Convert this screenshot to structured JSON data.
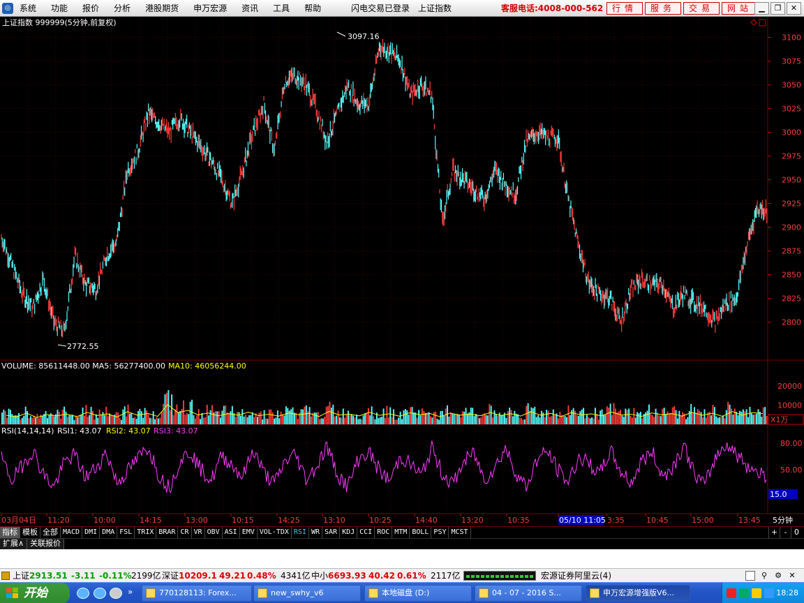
{
  "menubar": {
    "items": [
      "系统",
      "功能",
      "报价",
      "分析",
      "港股期货",
      "申万宏源",
      "资讯",
      "工具",
      "帮助"
    ],
    "login_status": "闪电交易已登录",
    "current_index": "上证指数",
    "hotline": "客服电话:4008-000-562",
    "quick_buttons": [
      "行情",
      "服务",
      "交易",
      "网站"
    ],
    "window_controls": [
      "minimize-icon",
      "restore-icon",
      "close-icon"
    ]
  },
  "chart": {
    "title": "上证指数 999999(5分钟,前复权)",
    "high_label": "3097.16",
    "low_label": "2772.55",
    "price_ticks": [
      3100,
      3075,
      3050,
      3025,
      3000,
      2975,
      2950,
      2925,
      2900,
      2875,
      2850,
      2825,
      2800
    ],
    "price_range": [
      2760,
      3110
    ],
    "close_line": [
      2890,
      2860,
      2830,
      2815,
      2845,
      2800,
      2790,
      2870,
      2840,
      2835,
      2870,
      2885,
      2960,
      2980,
      3020,
      3010,
      3000,
      3015,
      3000,
      2985,
      2970,
      2950,
      2925,
      2960,
      3000,
      3030,
      2980,
      3055,
      3060,
      3050,
      3025,
      2990,
      3020,
      3050,
      3030,
      3030,
      3090,
      3085,
      3075,
      3040,
      3050,
      3040,
      2905,
      2960,
      2950,
      2940,
      2930,
      2960,
      2945,
      2935,
      2990,
      3000,
      2995,
      2995,
      2930,
      2880,
      2840,
      2830,
      2825,
      2800,
      2835,
      2845,
      2840,
      2840,
      2815,
      2830,
      2820,
      2815,
      2800,
      2820,
      2825,
      2880,
      2920,
      2918
    ]
  },
  "volume": {
    "label": "VOLUME: 85611448.00  MA5: 56277400.00  ",
    "ma10_label": "MA10: 46056244.00",
    "ticks": [
      "20000",
      "10000"
    ],
    "range": [
      0,
      27000
    ],
    "unit": "X1万",
    "bars": [
      7200,
      6000,
      9000,
      5400,
      7800,
      6800,
      8200,
      6200,
      9600,
      7100,
      8400,
      5900,
      10200,
      7300,
      8800,
      6400,
      15800,
      9400,
      11200,
      7600,
      9100,
      6900,
      8600,
      7400,
      9800,
      7000,
      8100,
      6600,
      9200,
      7700,
      8900,
      6300,
      10400,
      7500,
      8200,
      6800,
      9700,
      7200,
      8500,
      6500,
      9300,
      7800,
      8700,
      6100,
      9000,
      7400,
      8300,
      6900,
      9500,
      7100,
      8600,
      6700,
      10100,
      7300,
      8800,
      6200,
      9400,
      7600,
      8400,
      6800,
      9900,
      7500,
      8100,
      6400,
      9200,
      7700,
      8600,
      6600,
      9600,
      7300,
      8900,
      6500,
      10300,
      7400,
      9500,
      8600
    ]
  },
  "rsi": {
    "label_prefix": "RSI(14,14,14)",
    "rsi1_label": "RSI1: 43.07",
    "rsi2_label": "RSI2: 43.07",
    "rsi3_label": "RSI3: 43.07",
    "ticks": [
      "80.00",
      "50.00"
    ],
    "current_box": "15.0",
    "range": [
      0,
      100
    ],
    "values": [
      62,
      38,
      55,
      72,
      45,
      30,
      58,
      67,
      41,
      52,
      70,
      35,
      48,
      63,
      76,
      44,
      29,
      60,
      71,
      50,
      38,
      66,
      55,
      42,
      73,
      47,
      34,
      59,
      68,
      40,
      53,
      77,
      45,
      31,
      62,
      70,
      49,
      37,
      65,
      56,
      43,
      74,
      46,
      33,
      58,
      69,
      39,
      52,
      75,
      47,
      30,
      61,
      71,
      50,
      36,
      64,
      57,
      44,
      72,
      48,
      35,
      60,
      70,
      42,
      54,
      78,
      46,
      32,
      63,
      80,
      68,
      55,
      48,
      43
    ]
  },
  "time_axis": {
    "labels": [
      "03月04日",
      "11:20",
      "10:00",
      "14:15",
      "13:00",
      "10:15",
      "14:25",
      "13:10",
      "10:25",
      "14:40",
      "13:20",
      "10:35",
      "05/10 11:05",
      "3:35",
      "10:45",
      "15:00",
      "13:45"
    ],
    "period": "5分钟"
  },
  "tabs": [
    "指标",
    "模板",
    "全部",
    "MACD",
    "DMI",
    "DMA",
    "FSL",
    "TRIX",
    "BRAR",
    "CR",
    "VR",
    "OBV",
    "ASI",
    "EMV",
    "VOL-TDX",
    "RSI",
    "WR",
    "SAR",
    "KDJ",
    "CCI",
    "ROC",
    "MTM",
    "BOLL",
    "PSY",
    "MCST"
  ],
  "tab_controls": [
    "+",
    "-",
    "0"
  ],
  "ext_tabs": [
    "扩展∧",
    "关联报价"
  ],
  "status": {
    "sh_label": "上证",
    "sh_value": "2913.51",
    "sh_change": "-3.11",
    "sh_pct": "-0.11%",
    "sh_amount": "2199亿",
    "sz_label": "深证",
    "sz_value": "10209.1",
    "sz_change": "49.21",
    "sz_pct": "0.48%",
    "sz_amount": "4341亿",
    "zx_label": "中小",
    "zx_value": "6693.93",
    "zx_change": "40.42",
    "zx_pct": "0.61%",
    "zx_amount": "2117亿",
    "broker": "宏源证券阿里云(4)"
  },
  "taskbar": {
    "start": "开始",
    "more": "»",
    "tasks": [
      "770128113: Forex...",
      "new_swhy_v6",
      "本地磁盘 (D:)",
      "04 - 07 - 2016 S...",
      "申万宏源增强版V6..."
    ],
    "clock": "18:28"
  },
  "colors": {
    "up": "#ff3c3c",
    "down": "#54ffff",
    "grid": "#7a0000",
    "rsi": "#ff3cff",
    "ma10": "#ffff00"
  }
}
